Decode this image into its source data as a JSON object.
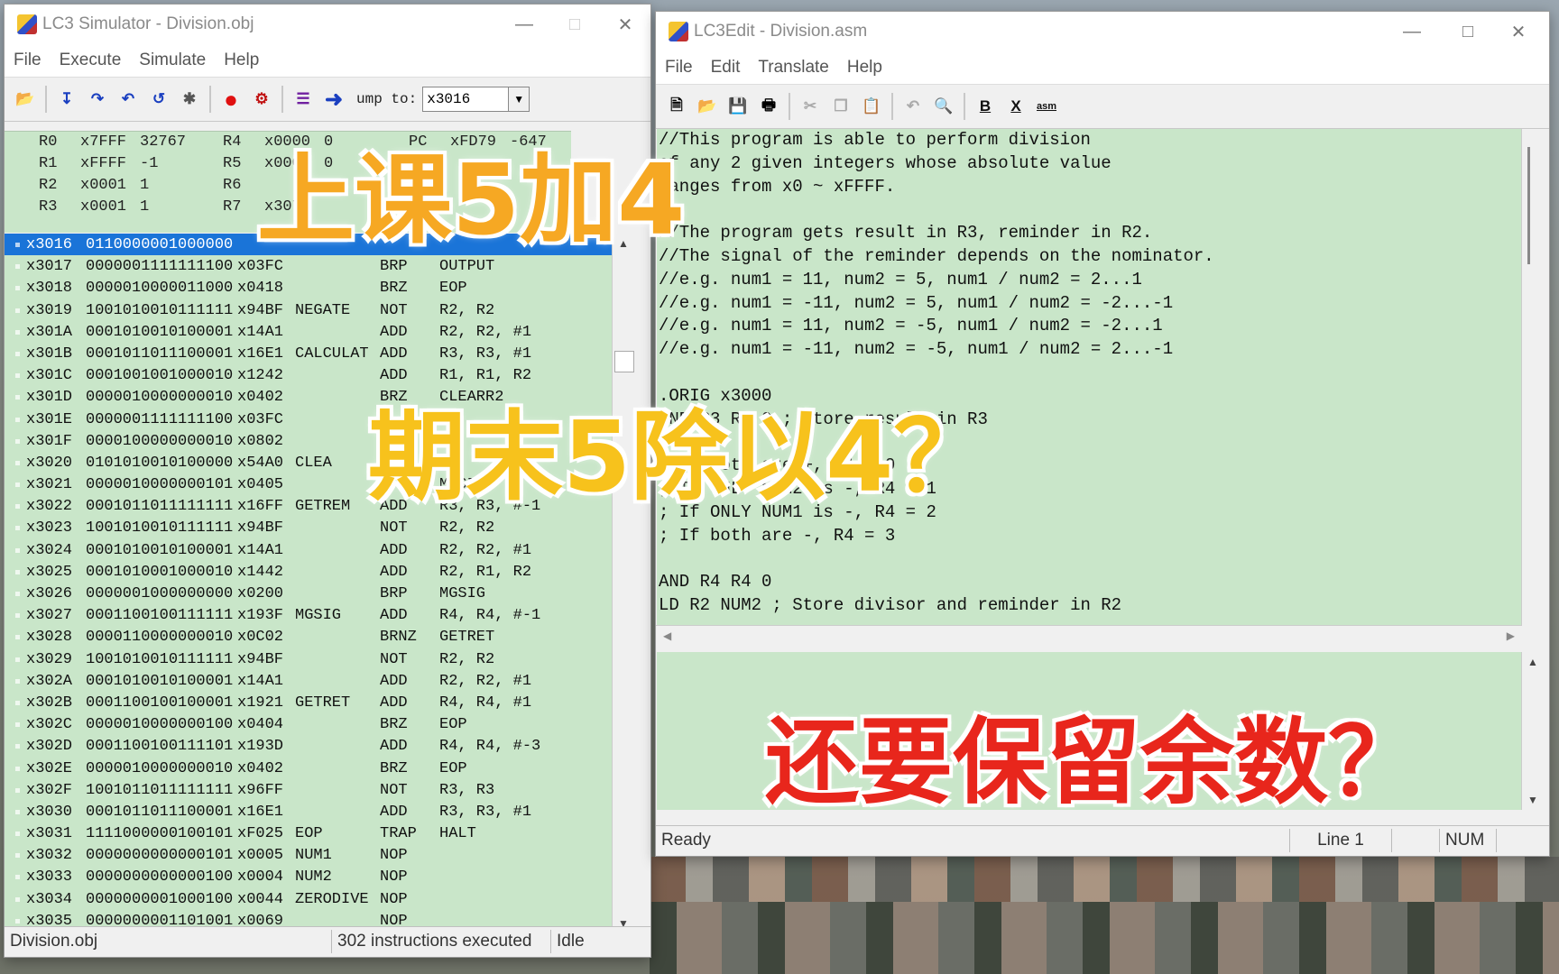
{
  "simulator": {
    "title": "LC3 Simulator - Division.obj",
    "menu": [
      "File",
      "Execute",
      "Simulate",
      "Help"
    ],
    "jump_label": "ump to:",
    "jump_value": "x3016",
    "registers": [
      {
        "n1": "R0",
        "h1": "x7FFF",
        "d1": "32767",
        "n2": "R4",
        "h2": "x0000",
        "d2": "0",
        "n3": "PC",
        "h3": "xFD79",
        "d3": "-647"
      },
      {
        "n1": "R1",
        "h1": "xFFFF",
        "d1": "-1",
        "n2": "R5",
        "h2": "x0000",
        "d2": "0",
        "n3": "",
        "h3": "",
        "d3": ""
      },
      {
        "n1": "R2",
        "h1": "x0001",
        "d1": "1",
        "n2": "R6",
        "h2": "",
        "d2": "",
        "n3": "",
        "h3": "",
        "d3": ""
      },
      {
        "n1": "R3",
        "h1": "x0001",
        "d1": "1",
        "n2": "R7",
        "h2": "x3075",
        "d2": "",
        "n3": "",
        "h3": "",
        "d3": ""
      }
    ],
    "memory": [
      {
        "addr": "x3016",
        "bin": "0110000001000000",
        "hex": "",
        "label": "",
        "op": "",
        "args": ""
      },
      {
        "addr": "x3017",
        "bin": "0000001111111100",
        "hex": "x03FC",
        "label": "",
        "op": "BRP",
        "args": "OUTPUT"
      },
      {
        "addr": "x3018",
        "bin": "0000010000011000",
        "hex": "x0418",
        "label": "",
        "op": "BRZ",
        "args": "EOP"
      },
      {
        "addr": "x3019",
        "bin": "1001010010111111",
        "hex": "x94BF",
        "label": "NEGATE",
        "op": "NOT",
        "args": "R2, R2"
      },
      {
        "addr": "x301A",
        "bin": "0001010010100001",
        "hex": "x14A1",
        "label": "",
        "op": "ADD",
        "args": "R2, R2, #1"
      },
      {
        "addr": "x301B",
        "bin": "0001011011100001",
        "hex": "x16E1",
        "label": "CALCULAT",
        "op": "ADD",
        "args": "R3, R3, #1"
      },
      {
        "addr": "x301C",
        "bin": "0001001001000010",
        "hex": "x1242",
        "label": "",
        "op": "ADD",
        "args": "R1, R1, R2"
      },
      {
        "addr": "x301D",
        "bin": "0000010000000010",
        "hex": "x0402",
        "label": "",
        "op": "BRZ",
        "args": "CLEARR2"
      },
      {
        "addr": "x301E",
        "bin": "0000001111111100",
        "hex": "x03FC",
        "label": "",
        "op": "",
        "args": ""
      },
      {
        "addr": "x301F",
        "bin": "0000100000000010",
        "hex": "x0802",
        "label": "",
        "op": "",
        "args": ""
      },
      {
        "addr": "x3020",
        "bin": "0101010010100000",
        "hex": "x54A0",
        "label": "CLEA",
        "op": "",
        "args": ""
      },
      {
        "addr": "x3021",
        "bin": "0000010000000101",
        "hex": "x0405",
        "label": "",
        "op": "",
        "args": "MGSI"
      },
      {
        "addr": "x3022",
        "bin": "0001011011111111",
        "hex": "x16FF",
        "label": "GETREM",
        "op": "ADD",
        "args": "R3, R3, #-1"
      },
      {
        "addr": "x3023",
        "bin": "1001010010111111",
        "hex": "x94BF",
        "label": "",
        "op": "NOT",
        "args": "R2, R2"
      },
      {
        "addr": "x3024",
        "bin": "0001010010100001",
        "hex": "x14A1",
        "label": "",
        "op": "ADD",
        "args": "R2, R2, #1"
      },
      {
        "addr": "x3025",
        "bin": "0001010001000010",
        "hex": "x1442",
        "label": "",
        "op": "ADD",
        "args": "R2, R1, R2"
      },
      {
        "addr": "x3026",
        "bin": "0000001000000000",
        "hex": "x0200",
        "label": "",
        "op": "BRP",
        "args": "MGSIG"
      },
      {
        "addr": "x3027",
        "bin": "0001100100111111",
        "hex": "x193F",
        "label": "MGSIG",
        "op": "ADD",
        "args": "R4, R4, #-1"
      },
      {
        "addr": "x3028",
        "bin": "0000110000000010",
        "hex": "x0C02",
        "label": "",
        "op": "BRNZ",
        "args": "GETRET"
      },
      {
        "addr": "x3029",
        "bin": "1001010010111111",
        "hex": "x94BF",
        "label": "",
        "op": "NOT",
        "args": "R2, R2"
      },
      {
        "addr": "x302A",
        "bin": "0001010010100001",
        "hex": "x14A1",
        "label": "",
        "op": "ADD",
        "args": "R2, R2, #1"
      },
      {
        "addr": "x302B",
        "bin": "0001100100100001",
        "hex": "x1921",
        "label": "GETRET",
        "op": "ADD",
        "args": "R4, R4, #1"
      },
      {
        "addr": "x302C",
        "bin": "0000010000000100",
        "hex": "x0404",
        "label": "",
        "op": "BRZ",
        "args": "EOP"
      },
      {
        "addr": "x302D",
        "bin": "0001100100111101",
        "hex": "x193D",
        "label": "",
        "op": "ADD",
        "args": "R4, R4, #-3"
      },
      {
        "addr": "x302E",
        "bin": "0000010000000010",
        "hex": "x0402",
        "label": "",
        "op": "BRZ",
        "args": "EOP"
      },
      {
        "addr": "x302F",
        "bin": "1001011011111111",
        "hex": "x96FF",
        "label": "",
        "op": "NOT",
        "args": "R3, R3"
      },
      {
        "addr": "x3030",
        "bin": "0001011011100001",
        "hex": "x16E1",
        "label": "",
        "op": "ADD",
        "args": "R3, R3, #1"
      },
      {
        "addr": "x3031",
        "bin": "1111000000100101",
        "hex": "xF025",
        "label": "EOP",
        "op": "TRAP",
        "args": "HALT"
      },
      {
        "addr": "x3032",
        "bin": "0000000000000101",
        "hex": "x0005",
        "label": "NUM1",
        "op": "NOP",
        "args": ""
      },
      {
        "addr": "x3033",
        "bin": "0000000000000100",
        "hex": "x0004",
        "label": "NUM2",
        "op": "NOP",
        "args": ""
      },
      {
        "addr": "x3034",
        "bin": "0000000001000100",
        "hex": "x0044",
        "label": "ZERODIVE",
        "op": "NOP",
        "args": ""
      },
      {
        "addr": "x3035",
        "bin": "0000000001101001",
        "hex": "x0069",
        "label": "",
        "op": "NOP",
        "args": ""
      }
    ],
    "status": {
      "file": "Division.obj",
      "executed": "302 instructions executed",
      "state": "Idle"
    }
  },
  "editor": {
    "title": "LC3Edit - Division.asm",
    "menu": [
      "File",
      "Edit",
      "Translate",
      "Help"
    ],
    "code": [
      "//This program is able to perform division",
      "of any 2 given integers whose absolute value",
      "ranges from x0 ~ xFFFF.",
      "",
      "//The program gets result in R3, reminder in R2.",
      "//The signal of the reminder depends on the nominator.",
      "//e.g. num1 = 11, num2 = 5, num1 / num2 = 2...1",
      "//e.g. num1 = -11, num2 = 5, num1 / num2 = -2...-1",
      "//e.g. num1 = 11, num2 = -5, num1 / num2 = -2...1",
      "//e.g. num1 = -11, num2 = -5, num1 / num2 = 2...-1",
      "",
      ".ORIG x3000",
      "AND R3 R3 0 ; Store result in R3",
      "",
      "; If both are +, R4 = 0",
      "; If ONLY NUM2 is -, R4 = 1",
      "; If ONLY NUM1 is -, R4 = 2",
      "; If both are -, R4 = 3",
      "",
      "AND R4 R4 0",
      "LD R2 NUM2 ; Store divisor and reminder in R2"
    ],
    "status": {
      "state": "Ready",
      "line": "Line 1",
      "num": "NUM"
    }
  },
  "overlays": {
    "line1": "上课5加4",
    "line2": "期末5除以4？",
    "line3": "还要保留余数？"
  },
  "colors": {
    "code_bg": "#c9e6c9",
    "selection": "#1a74d8",
    "overlay_orange": "#f6a823",
    "overlay_yellow": "#f7c21c",
    "overlay_red": "#e8261c"
  }
}
